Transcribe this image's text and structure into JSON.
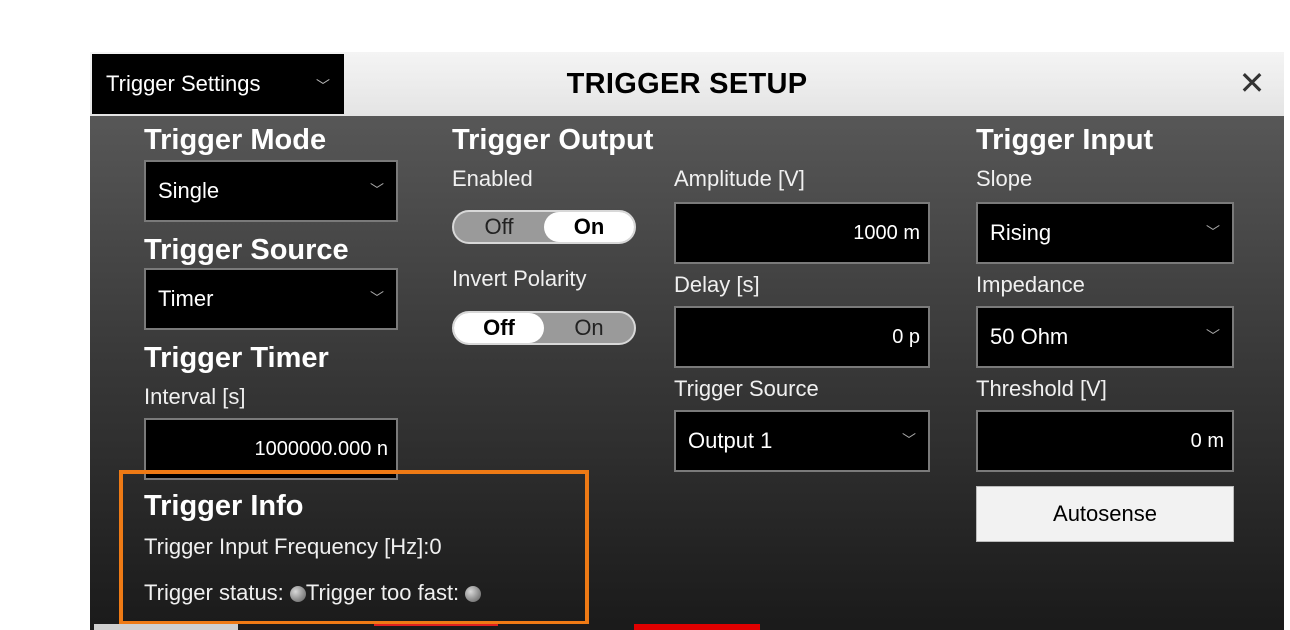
{
  "window": {
    "view_select": "Trigger Settings",
    "title": "TRIGGER SETUP",
    "close_glyph": "✕"
  },
  "trigger_mode": {
    "heading": "Trigger Mode",
    "value": "Single"
  },
  "trigger_source": {
    "heading": "Trigger Source",
    "value": "Timer"
  },
  "trigger_timer": {
    "heading": "Trigger Timer",
    "interval_label": "Interval [s]",
    "interval_value": "1000000.000 n"
  },
  "trigger_info": {
    "heading": "Trigger Info",
    "freq_label": "Trigger Input Frequency  [Hz]:",
    "freq_value": "0",
    "status_label": "Trigger status:",
    "too_fast_label": "Trigger too fast:"
  },
  "trigger_output": {
    "heading": "Trigger Output",
    "enabled_label": "Enabled",
    "enabled_off": "Off",
    "enabled_on": "On",
    "enabled_state": "On",
    "invert_label": "Invert Polarity",
    "invert_off": "Off",
    "invert_on": "On",
    "invert_state": "Off",
    "amplitude_label": "Amplitude [V]",
    "amplitude_value": "1000 m",
    "delay_label": "Delay [s]",
    "delay_value": "0 p",
    "source_label": "Trigger Source",
    "source_value": "Output 1"
  },
  "trigger_input": {
    "heading": "Trigger Input",
    "slope_label": "Slope",
    "slope_value": "Rising",
    "impedance_label": "Impedance",
    "impedance_value": "50 Ohm",
    "threshold_label": "Threshold [V]",
    "threshold_value": "0 m",
    "autosense_label": "Autosense"
  },
  "colors": {
    "highlight": "#ee7a15",
    "panel_top": "#575757",
    "panel_bottom": "#1a1a1a",
    "led": "#9a9a9a"
  }
}
